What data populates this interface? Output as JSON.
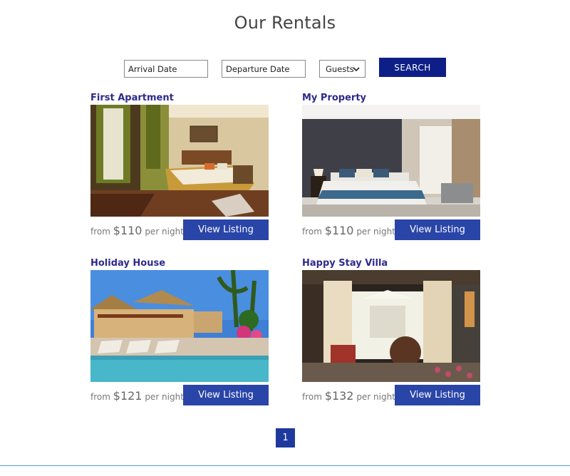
{
  "page": {
    "title": "Our Rentals"
  },
  "search": {
    "arrival_placeholder": "Arrival Date",
    "departure_placeholder": "Departure Date",
    "guests_label": "Guests",
    "button_label": "SEARCH"
  },
  "listings": [
    {
      "title": "First Apartment",
      "price_prefix": "from",
      "price": "$110",
      "price_suffix": "per night",
      "button_label": "View Listing"
    },
    {
      "title": "My Property",
      "price_prefix": "from",
      "price": "$110",
      "price_suffix": "per night",
      "button_label": "View Listing"
    },
    {
      "title": "Holiday House",
      "price_prefix": "from",
      "price": "$121",
      "price_suffix": "per night",
      "button_label": "View Listing"
    },
    {
      "title": "Happy Stay Villa",
      "price_prefix": "from",
      "price": "$132",
      "price_suffix": "per night",
      "button_label": "View Listing"
    }
  ],
  "pagination": {
    "current_page": "1"
  },
  "colors": {
    "search_button": "#0d1f87",
    "view_button": "#2a45a8",
    "title_text": "#2e2a8c",
    "footer_rule": "#4aa3d8"
  },
  "icons": {
    "guests_dropdown": "chevron-down-icon"
  }
}
